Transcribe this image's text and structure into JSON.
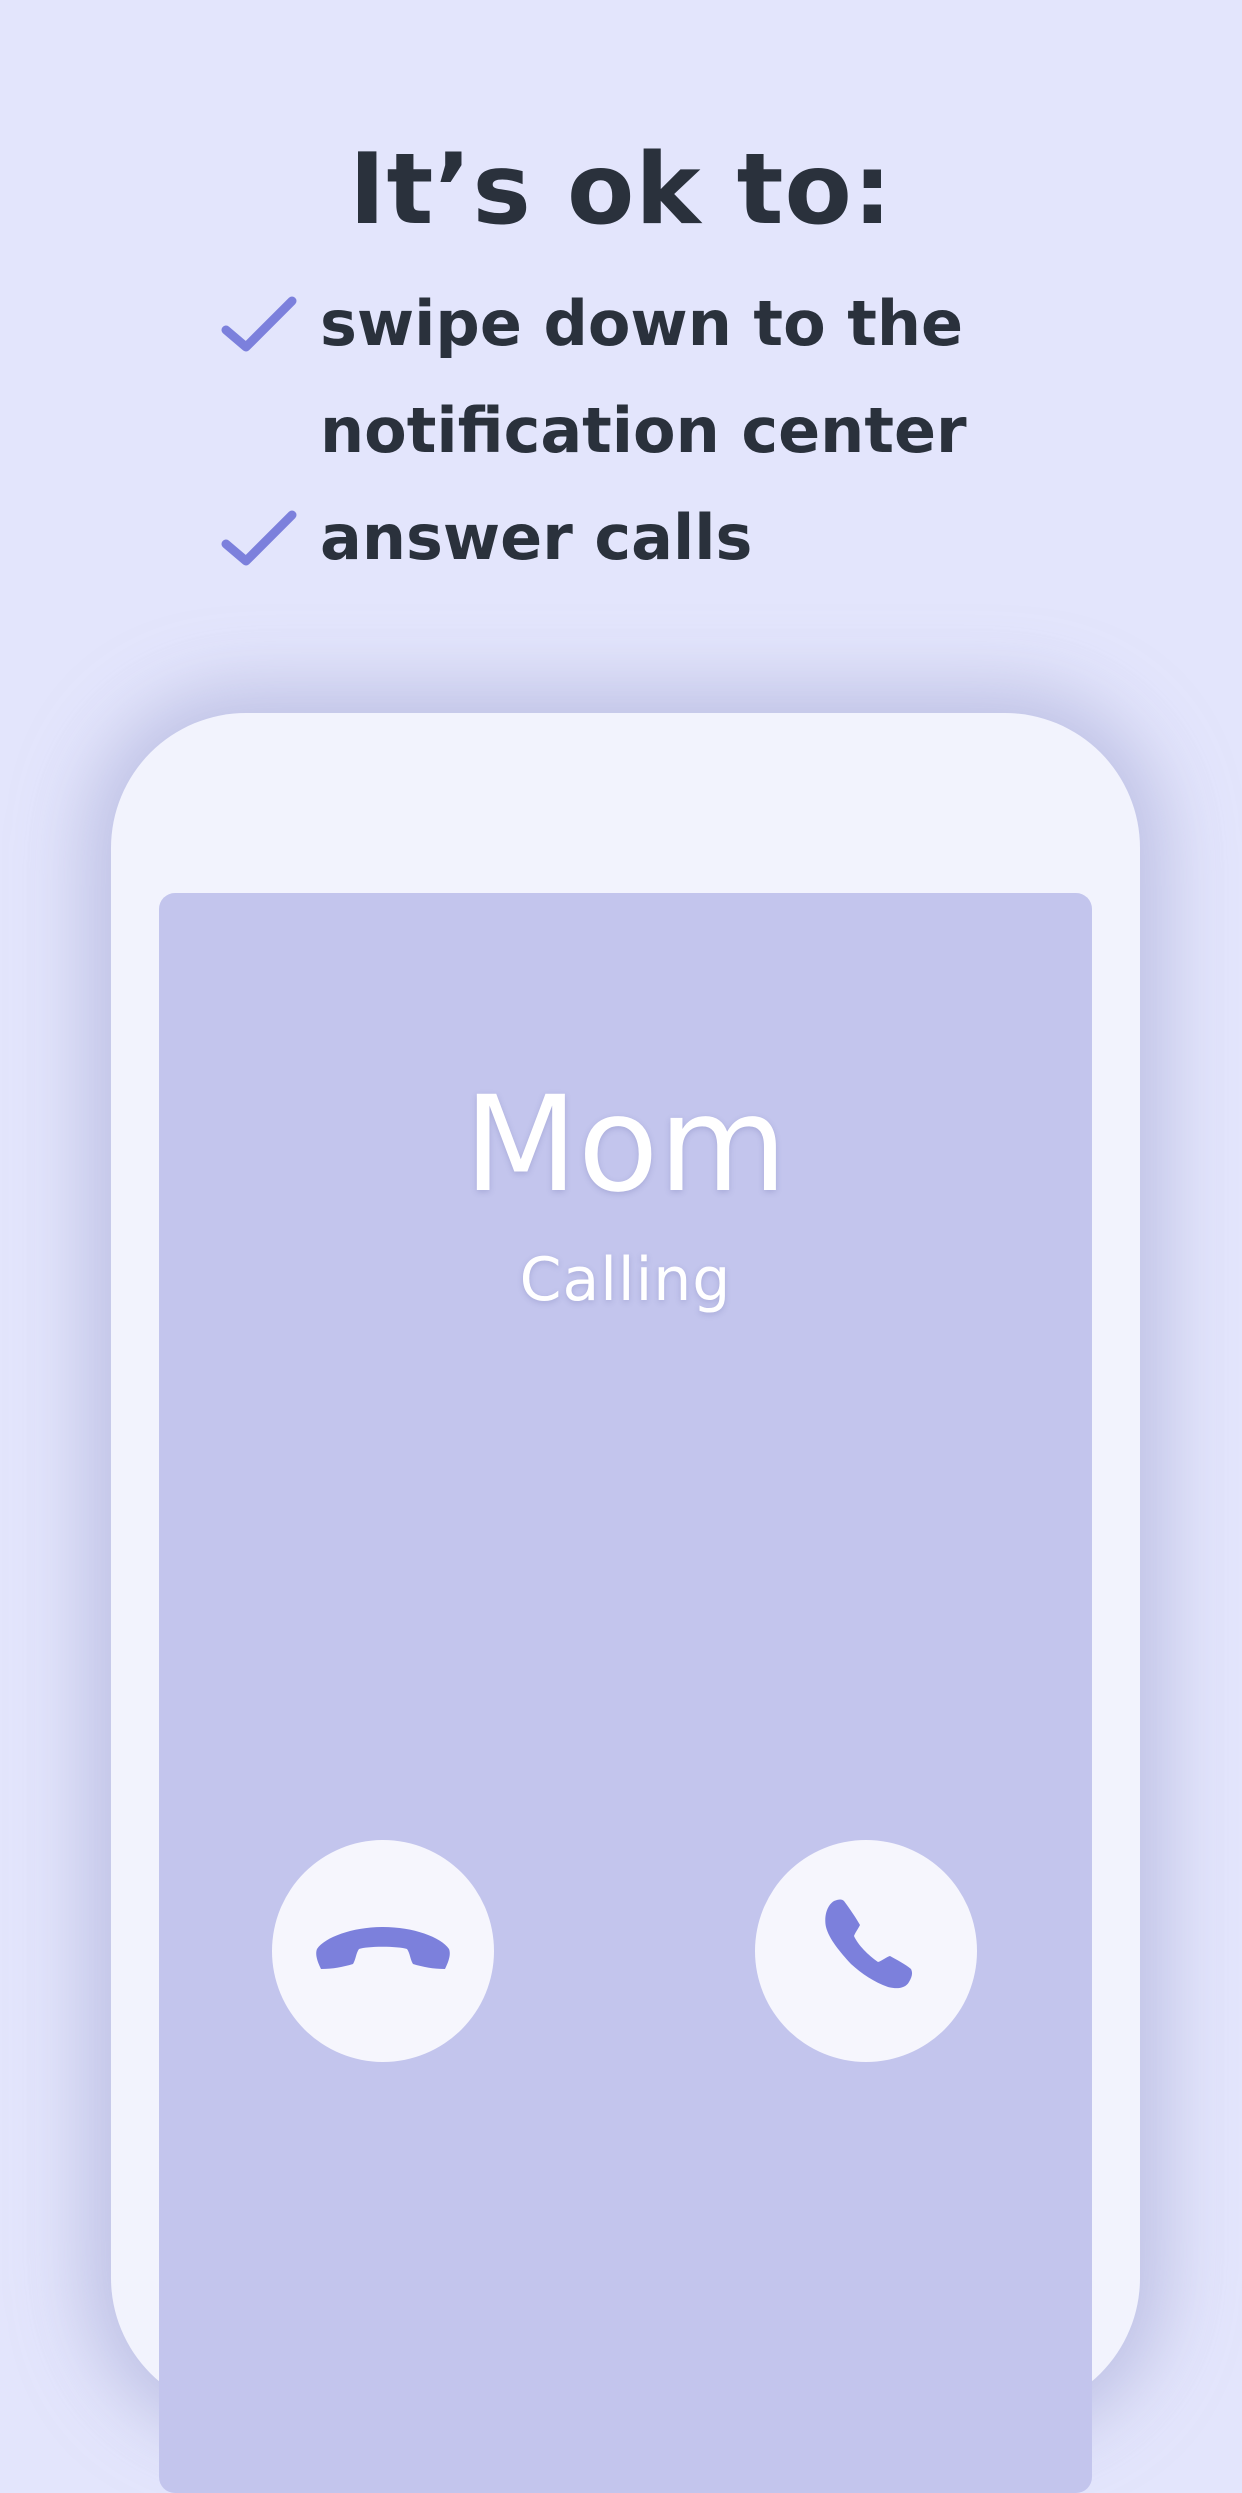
{
  "intro": {
    "heading": "It’s ok to:",
    "items": [
      {
        "lines": [
          "swipe down to the",
          "notification center"
        ]
      },
      {
        "lines": [
          "answer calls"
        ]
      }
    ]
  },
  "call_screen": {
    "caller_name": "Mom",
    "status": "Calling",
    "decline_icon": "phone-hang-up-icon",
    "accept_icon": "phone-answer-icon"
  },
  "colors": {
    "background": "#e3e5fc",
    "text_dark": "#2a313c",
    "accent": "#7c80dc",
    "screen": "#c3c5ed",
    "phone_body": "#f2f3fd"
  }
}
